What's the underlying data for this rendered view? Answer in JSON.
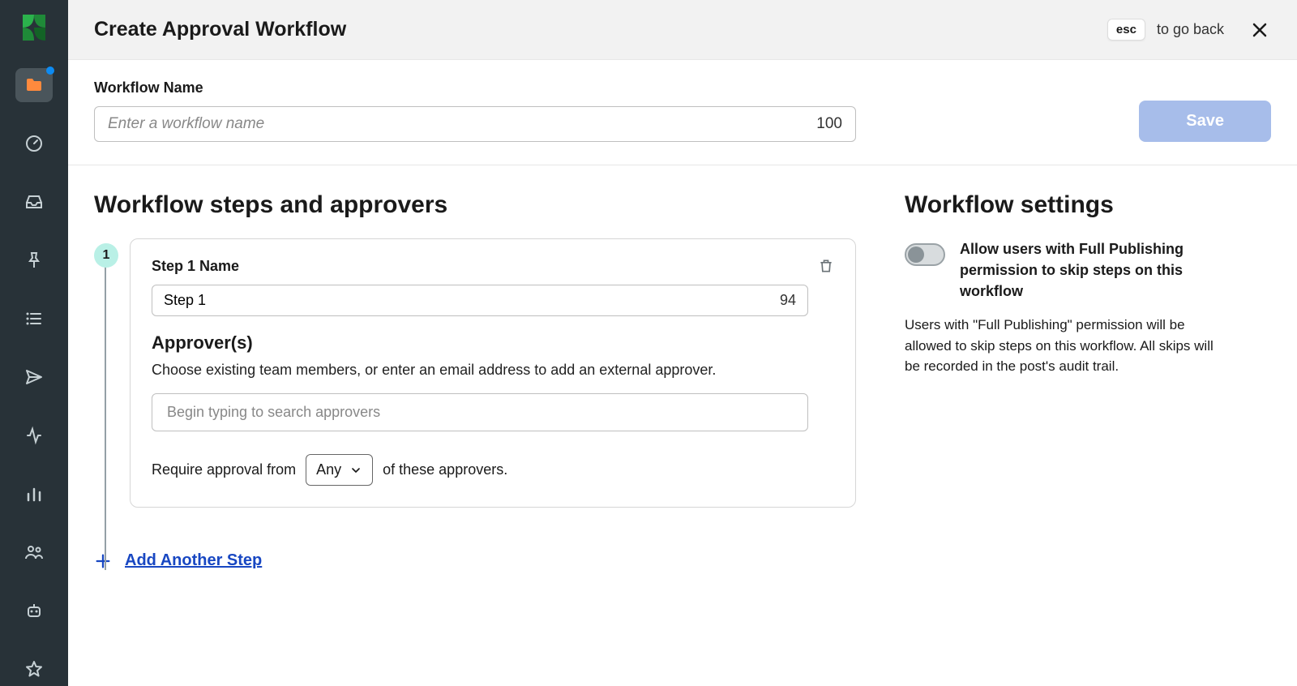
{
  "header": {
    "title": "Create Approval Workflow",
    "esc_key": "esc",
    "to_go_back": "to go back"
  },
  "workflow_name": {
    "label": "Workflow Name",
    "placeholder": "Enter a workflow name",
    "value": "",
    "char_limit": "100"
  },
  "save_label": "Save",
  "steps_section": {
    "title": "Workflow steps and approvers",
    "step1": {
      "badge": "1",
      "name_label": "Step 1 Name",
      "name_value": "Step 1",
      "name_chars_left": "94",
      "approvers_title": "Approver(s)",
      "approvers_help": "Choose existing team members, or enter an email address to add an external approver.",
      "approver_search_placeholder": "Begin typing to search approvers",
      "require_prefix": "Require approval from",
      "require_select": "Any",
      "require_suffix": "of these approvers."
    },
    "add_step_label": "Add Another Step"
  },
  "settings": {
    "title": "Workflow settings",
    "toggle_label": "Allow users with Full Publishing permission to skip steps on this workflow",
    "help": "Users with \"Full Publishing\" permission will be allowed to skip steps on this workflow. All skips will be recorded in the post's audit trail."
  },
  "sidebar": {
    "items": [
      "folder",
      "dashboard",
      "inbox",
      "pin",
      "list",
      "send",
      "activity",
      "bar-chart",
      "people",
      "bot",
      "star"
    ]
  }
}
